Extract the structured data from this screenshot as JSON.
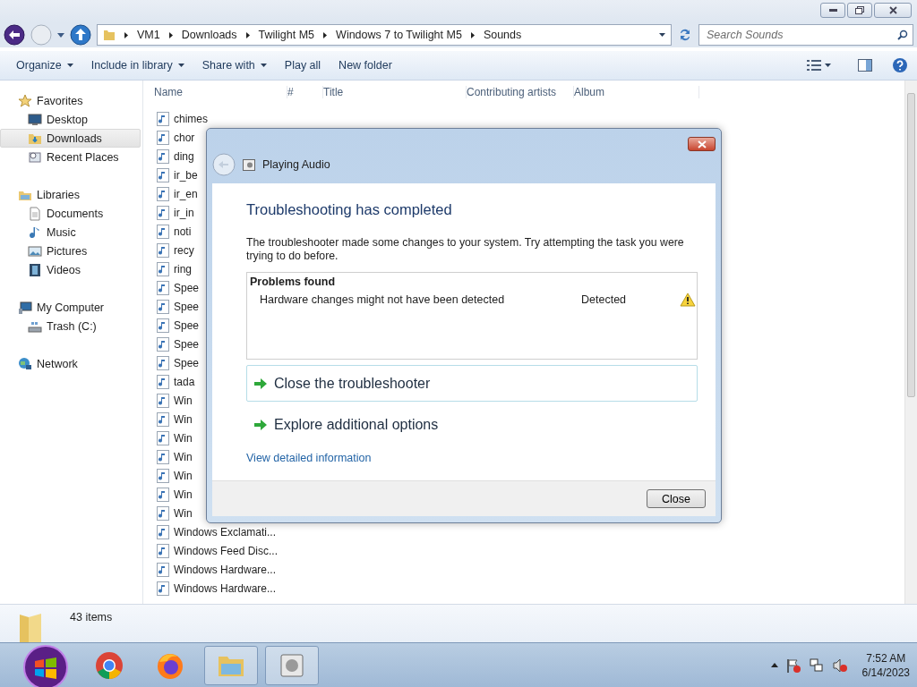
{
  "address": {
    "crumbs": [
      "VM1",
      "Downloads",
      "Twilight M5",
      "Windows 7 to Twilight M5",
      "Sounds"
    ]
  },
  "search": {
    "placeholder": "Search Sounds"
  },
  "toolbar": [
    {
      "label": "Organize",
      "kind": "menu"
    },
    {
      "label": "Include in library",
      "kind": "menu"
    },
    {
      "label": "Share with",
      "kind": "menu"
    },
    {
      "label": "Play all",
      "kind": "action"
    },
    {
      "label": "New folder",
      "kind": "action"
    }
  ],
  "sidebar": [
    {
      "label": "Favorites",
      "kind": "star",
      "children": [
        {
          "label": "Desktop",
          "kind": "desktop",
          "selected": false
        },
        {
          "label": "Downloads",
          "kind": "downloads",
          "selected": true
        },
        {
          "label": "Recent Places",
          "kind": "recent",
          "selected": false
        }
      ]
    },
    {
      "label": "Libraries",
      "kind": "library",
      "children": [
        {
          "label": "Documents",
          "kind": "document",
          "selected": false
        },
        {
          "label": "Music",
          "kind": "music",
          "selected": false
        },
        {
          "label": "Pictures",
          "kind": "pictures",
          "selected": false
        },
        {
          "label": "Videos",
          "kind": "videos",
          "selected": false
        }
      ]
    },
    {
      "label": "My Computer",
      "kind": "computer",
      "children": [
        {
          "label": "Trash (C:)",
          "kind": "drive",
          "selected": false
        }
      ]
    },
    {
      "label": "Network",
      "kind": "network"
    }
  ],
  "columns": [
    "Name",
    "#",
    "Title",
    "Contributing artists",
    "Album"
  ],
  "files": [
    "chimes",
    "chor",
    "ding",
    "ir_be",
    "ir_en",
    "ir_in",
    "noti",
    "recy",
    "ring",
    "Spee",
    "Spee",
    "Spee",
    "Spee",
    "Spee",
    "tada",
    "Win",
    "Win",
    "Win",
    "Win",
    "Win",
    "Win",
    "Win",
    "Windows Exclamati...",
    "Windows Feed Disc...",
    "Windows Hardware...",
    "Windows Hardware..."
  ],
  "status": {
    "count": "43 items"
  },
  "dialog": {
    "title": "Playing Audio",
    "heading": "Troubleshooting has completed",
    "message": "The troubleshooter made some changes to your system. Try attempting the task you were trying to do before.",
    "problems": {
      "heading": "Problems found",
      "rows": [
        {
          "problem": "Hardware changes might not have been detected",
          "status": "Detected"
        }
      ]
    },
    "options": [
      {
        "label": "Close the troubleshooter",
        "selected": true
      },
      {
        "label": "Explore additional options",
        "selected": false
      }
    ],
    "link": "View detailed information",
    "button": "Close"
  },
  "clock": {
    "time": "7:52 AM",
    "date": "6/14/2023"
  }
}
